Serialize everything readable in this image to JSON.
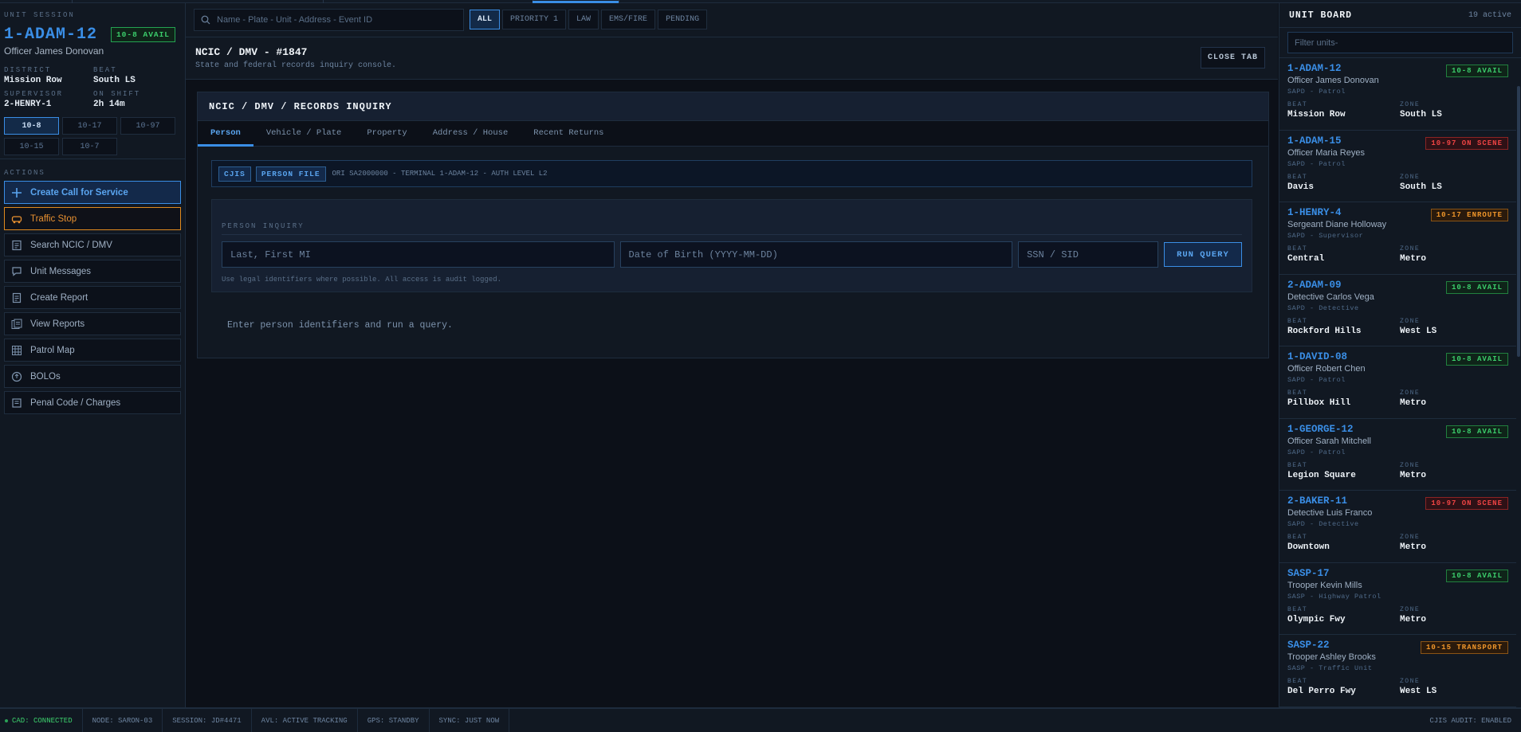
{
  "session": {
    "label": "UNIT SESSION",
    "unit_id": "1-ADAM-12",
    "status": "10-8 AVAIL",
    "officer": "Officer James Donovan",
    "fields": [
      {
        "label": "DISTRICT",
        "value": "Mission Row"
      },
      {
        "label": "BEAT",
        "value": "South LS"
      },
      {
        "label": "SUPERVISOR",
        "value": "2-HENRY-1"
      },
      {
        "label": "ON SHIFT",
        "value": "2h 14m"
      }
    ],
    "status_codes": [
      "10-8",
      "10-17",
      "10-97",
      "10-15",
      "10-7"
    ],
    "active_code": "10-8"
  },
  "actions": {
    "label": "ACTIONS",
    "items": [
      {
        "label": "Create Call for Service",
        "icon": "plus-icon",
        "style": "primary"
      },
      {
        "label": "Traffic Stop",
        "icon": "car-icon",
        "style": "warn"
      },
      {
        "label": "Search NCIC / DMV",
        "icon": "document-icon",
        "style": ""
      },
      {
        "label": "Unit Messages",
        "icon": "message-icon",
        "style": ""
      },
      {
        "label": "Create Report",
        "icon": "report-icon",
        "style": ""
      },
      {
        "label": "View Reports",
        "icon": "reports-icon",
        "style": ""
      },
      {
        "label": "Patrol Map",
        "icon": "grid-map-icon",
        "style": ""
      },
      {
        "label": "BOLOs",
        "icon": "alert-circle-icon",
        "style": ""
      },
      {
        "label": "Penal Code / Charges",
        "icon": "book-icon",
        "style": ""
      }
    ]
  },
  "search": {
    "placeholder": "Name - Plate - Unit - Address - Event ID",
    "filters": [
      "ALL",
      "PRIORITY 1",
      "LAW",
      "EMS/FIRE",
      "PENDING"
    ],
    "active_filter": "ALL"
  },
  "header": {
    "title": "NCIC / DMV - #1847",
    "subtitle": "State and federal records inquiry console.",
    "close_label": "CLOSE TAB"
  },
  "panel": {
    "title": "NCIC / DMV / RECORDS INQUIRY",
    "tabs": [
      "Person",
      "Vehicle / Plate",
      "Property",
      "Address / House",
      "Recent Returns"
    ],
    "active_tab": "Person",
    "tags": [
      "CJIS",
      "PERSON FILE"
    ],
    "ori": "ORI SA2000000 - TERMINAL 1-ADAM-12 - AUTH LEVEL L2",
    "inquiry_label": "PERSON INQUIRY",
    "name_placeholder": "Last, First MI",
    "dob_placeholder": "Date of Birth (YYYY-MM-DD)",
    "ssn_placeholder": "SSN / SID",
    "run_label": "RUN QUERY",
    "hint": "Use legal identifiers where possible. All access is audit logged.",
    "empty": "Enter person identifiers and run a query."
  },
  "unit_board": {
    "title": "UNIT BOARD",
    "count": "19 active",
    "filter_placeholder": "Filter units-",
    "beat_label": "BEAT",
    "zone_label": "ZONE",
    "units": [
      {
        "id": "1-ADAM-12",
        "name": "Officer James Donovan",
        "agency": "SAPD - Patrol",
        "beat": "Mission Row",
        "zone": "South LS",
        "status": "10-8 AVAIL",
        "kind": "avail"
      },
      {
        "id": "1-ADAM-15",
        "name": "Officer Maria Reyes",
        "agency": "SAPD - Patrol",
        "beat": "Davis",
        "zone": "South LS",
        "status": "10-97 ON SCENE",
        "kind": "scene"
      },
      {
        "id": "1-HENRY-4",
        "name": "Sergeant Diane Holloway",
        "agency": "SAPD - Supervisor",
        "beat": "Central",
        "zone": "Metro",
        "status": "10-17 ENROUTE",
        "kind": "enroute"
      },
      {
        "id": "2-ADAM-09",
        "name": "Detective Carlos Vega",
        "agency": "SAPD - Detective",
        "beat": "Rockford Hills",
        "zone": "West LS",
        "status": "10-8 AVAIL",
        "kind": "avail"
      },
      {
        "id": "1-DAVID-08",
        "name": "Officer Robert Chen",
        "agency": "SAPD - Patrol",
        "beat": "Pillbox Hill",
        "zone": "Metro",
        "status": "10-8 AVAIL",
        "kind": "avail"
      },
      {
        "id": "1-GEORGE-12",
        "name": "Officer Sarah Mitchell",
        "agency": "SAPD - Patrol",
        "beat": "Legion Square",
        "zone": "Metro",
        "status": "10-8 AVAIL",
        "kind": "avail"
      },
      {
        "id": "2-BAKER-11",
        "name": "Detective Luis Franco",
        "agency": "SAPD - Detective",
        "beat": "Downtown",
        "zone": "Metro",
        "status": "10-97 ON SCENE",
        "kind": "scene"
      },
      {
        "id": "SASP-17",
        "name": "Trooper Kevin Mills",
        "agency": "SASP - Highway Patrol",
        "beat": "Olympic Fwy",
        "zone": "Metro",
        "status": "10-8 AVAIL",
        "kind": "avail"
      },
      {
        "id": "SASP-22",
        "name": "Trooper Ashley Brooks",
        "agency": "SASP - Traffic Unit",
        "beat": "Del Perro Fwy",
        "zone": "West LS",
        "status": "10-15 TRANSPORT",
        "kind": "enroute"
      }
    ]
  },
  "status_colors": {
    "avail": {
      "fg": "#3ccf6c",
      "bg": "#0f2419",
      "border": "#22803f"
    },
    "scene": {
      "fg": "#ef4444",
      "bg": "#2e1116",
      "border": "#8c2424"
    },
    "enroute": {
      "fg": "#f0962a",
      "bg": "#2a1a0c",
      "border": "#8a5416"
    }
  },
  "statusbar": {
    "items": [
      "CAD: CONNECTED",
      "NODE: SARON-03",
      "SESSION: JD#4471",
      "AVL: ACTIVE TRACKING",
      "GPS: STANDBY",
      "SYNC: JUST NOW"
    ],
    "right": "CJIS AUDIT: ENABLED"
  }
}
